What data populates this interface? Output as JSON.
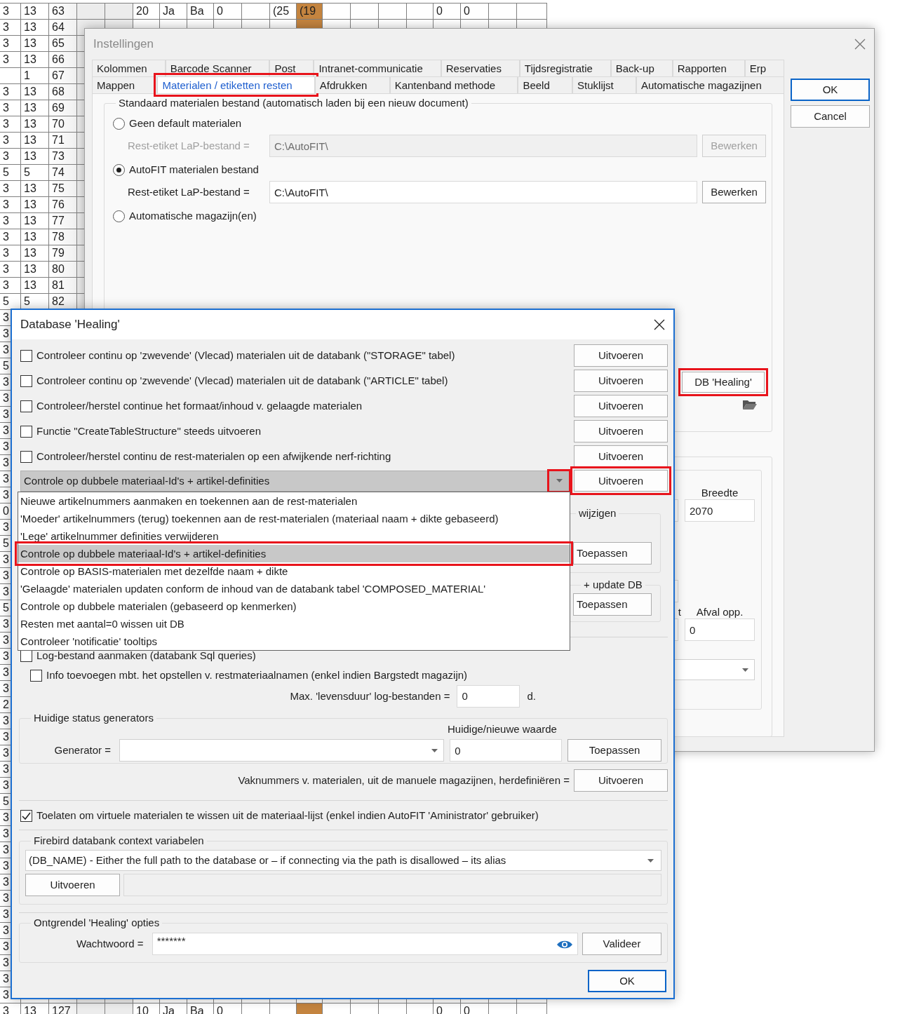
{
  "spreadsheet": {
    "rows": [
      {
        "cells": [
          "3",
          "13",
          "63",
          null,
          null,
          "20",
          "Ja",
          "Ba",
          "0",
          null,
          "(25",
          {
            "text": "(19",
            "color": "#c4843f"
          },
          null,
          null,
          null,
          null,
          "0",
          "0"
        ]
      },
      {
        "cells": [
          "3",
          "13",
          "64",
          null,
          null,
          null,
          null,
          null,
          null,
          null,
          null,
          {
            "color": "#c4843f"
          }
        ]
      },
      {
        "cells": [
          "3",
          "13",
          "65"
        ]
      },
      {
        "cells": [
          "3",
          "13",
          "66"
        ]
      },
      {
        "cells": [
          null,
          "1",
          "67"
        ]
      },
      {
        "cells": [
          "3",
          "13",
          "68"
        ]
      },
      {
        "cells": [
          "3",
          "13",
          "69"
        ]
      },
      {
        "cells": [
          "3",
          "13",
          "70"
        ]
      },
      {
        "cells": [
          "3",
          "13",
          "71"
        ]
      },
      {
        "cells": [
          "3",
          "13",
          "73"
        ]
      },
      {
        "cells": [
          "5",
          "5",
          "74"
        ]
      },
      {
        "cells": [
          "3",
          "13",
          "75"
        ]
      },
      {
        "cells": [
          "3",
          "13",
          "76"
        ]
      },
      {
        "cells": [
          "3",
          "13",
          "77"
        ]
      },
      {
        "cells": [
          "3",
          "13",
          "78"
        ]
      },
      {
        "cells": [
          "3",
          "13",
          "79"
        ]
      },
      {
        "cells": [
          "3",
          "13",
          "80"
        ]
      },
      {
        "cells": [
          "3",
          "13",
          "81"
        ]
      },
      {
        "cells": [
          "5",
          "5",
          "82"
        ]
      },
      {
        "cells": [
          "3"
        ]
      },
      {
        "cells": [
          "3"
        ]
      },
      {
        "cells": [
          "3"
        ]
      },
      {
        "cells": [
          "5"
        ]
      },
      {
        "cells": [
          "3"
        ]
      },
      {
        "cells": [
          "3"
        ]
      },
      {
        "cells": [
          "3"
        ]
      },
      {
        "cells": [
          "3"
        ]
      },
      {
        "cells": [
          "3"
        ]
      },
      {
        "cells": [
          "3"
        ]
      },
      {
        "cells": [
          "3"
        ]
      },
      {
        "cells": [
          "3"
        ]
      },
      {
        "cells": [
          "0"
        ]
      },
      {
        "cells": [
          "3"
        ]
      },
      {
        "cells": [
          "5"
        ]
      },
      {
        "cells": [
          "3"
        ]
      },
      {
        "cells": [
          "3"
        ]
      },
      {
        "cells": [
          "3"
        ]
      },
      {
        "cells": [
          "5"
        ]
      },
      {
        "cells": [
          "3"
        ]
      },
      {
        "cells": [
          "3"
        ]
      },
      {
        "cells": [
          "3"
        ]
      },
      {
        "cells": [
          "3"
        ]
      },
      {
        "cells": [
          "3"
        ]
      },
      {
        "cells": [
          "2"
        ]
      },
      {
        "cells": [
          "3"
        ]
      },
      {
        "cells": [
          "3"
        ]
      },
      {
        "cells": [
          "3"
        ]
      },
      {
        "cells": [
          "3"
        ]
      },
      {
        "cells": [
          "3"
        ]
      },
      {
        "cells": [
          "5"
        ]
      },
      {
        "cells": [
          "3"
        ]
      },
      {
        "cells": [
          "3"
        ]
      },
      {
        "cells": [
          "3"
        ]
      },
      {
        "cells": [
          "3"
        ]
      },
      {
        "cells": [
          "3"
        ]
      },
      {
        "cells": [
          "3"
        ]
      },
      {
        "cells": [
          "3"
        ]
      },
      {
        "cells": [
          "3"
        ]
      },
      {
        "cells": [
          "3"
        ]
      },
      {
        "cells": [
          "3"
        ]
      },
      {
        "cells": [
          "3"
        ]
      },
      {
        "cells": [
          "3"
        ]
      },
      {
        "cells": [
          "3",
          "13",
          "127",
          null,
          null,
          "10",
          "Ja",
          "Ba",
          "0",
          null,
          null,
          {
            "color": "#c4843f"
          },
          null,
          null,
          null,
          null,
          "0",
          "0"
        ]
      }
    ]
  },
  "settings_window": {
    "title": "Instellingen",
    "active": false,
    "tab_rows": [
      [
        {
          "label": "Kolommen",
          "selected": false,
          "annotated": false
        },
        {
          "label": "Barcode Scanner",
          "selected": false,
          "annotated": false
        },
        {
          "label": "Post",
          "selected": false,
          "annotated": false
        },
        {
          "label": "Intranet-communicatie",
          "selected": false,
          "annotated": false
        },
        {
          "label": "Reservaties",
          "selected": false,
          "annotated": false
        },
        {
          "label": "Tijdsregistratie",
          "selected": false,
          "annotated": false
        },
        {
          "label": "Back-up",
          "selected": false,
          "annotated": false
        },
        {
          "label": "Rapporten",
          "selected": false,
          "annotated": false
        },
        {
          "label": "Erp",
          "selected": false,
          "annotated": false
        }
      ],
      [
        {
          "label": "Mappen",
          "selected": false,
          "annotated": false
        },
        {
          "label": "Materialen / etiketten resten",
          "selected": true,
          "annotated": true
        },
        {
          "label": "Afdrukken",
          "selected": false,
          "annotated": false
        },
        {
          "label": "Kantenband methode",
          "selected": false,
          "annotated": false
        },
        {
          "label": "Beeld",
          "selected": false,
          "annotated": false
        },
        {
          "label": "Stuklijst",
          "selected": false,
          "annotated": false
        },
        {
          "label": "Automatische magazijnen",
          "selected": false,
          "annotated": false
        }
      ]
    ],
    "group_title": "Standaard materialen bestand (automatisch laden bij een nieuw document)",
    "options": [
      {
        "label": "Geen default materialen",
        "selected": false,
        "file_label": "Rest-etiket LaP-bestand =",
        "path": "C:\\AutoFIT\\",
        "button": "Bewerken",
        "disabled": true
      },
      {
        "label": "AutoFIT materialen bestand",
        "selected": true,
        "file_label": "Rest-etiket LaP-bestand =",
        "path": "C:\\AutoFIT\\",
        "button": "Bewerken",
        "disabled": false
      },
      {
        "label": "Automatische magazijn(en)",
        "selected": false
      }
    ],
    "healing_button": {
      "label": "DB 'Healing'",
      "annotated": true
    },
    "dimensions": {
      "width_label": "Breedte",
      "width_value": "2070",
      "partial_label": "t",
      "waste_label": "Afval opp.",
      "waste_value": "0"
    },
    "buttons": [
      {
        "label": "OK",
        "default": true
      },
      {
        "label": "Cancel",
        "default": false
      }
    ]
  },
  "healing_dialog": {
    "title": "Database 'Healing'",
    "checks": [
      {
        "label": "Controleer continu op 'zwevende' (Vlecad) materialen uit de databank (\"STORAGE\" tabel)",
        "checked": false,
        "button": "Uitvoeren"
      },
      {
        "label": "Controleer continu op 'zwevende' (Vlecad) materialen uit de databank (\"ARTICLE\" tabel)",
        "checked": false,
        "button": "Uitvoeren"
      },
      {
        "label": "Controleer/herstel continue het formaat/inhoud v. gelaagde materialen",
        "checked": false,
        "button": "Uitvoeren"
      },
      {
        "label": "Functie \"CreateTableStructure\" steeds uitvoeren",
        "checked": false,
        "button": "Uitvoeren"
      },
      {
        "label": "Controleer/herstel continu de rest-materialen op een afwijkende nerf-richting",
        "checked": false,
        "button": "Uitvoeren"
      }
    ],
    "action": {
      "value": "Controle op dubbele materiaal-Id's + artikel-definities",
      "expanded": true,
      "annotated": true,
      "button": "Uitvoeren",
      "button_annotated": true
    },
    "action_options": [
      {
        "label": "Nieuwe artikelnummers aanmaken en toekennen aan de rest-materialen",
        "selected": false,
        "annotated": false
      },
      {
        "label": "'Moeder' artikelnummers (terug) toekennen aan de rest-materialen (materiaal naam + dikte gebaseerd)",
        "selected": false,
        "annotated": false
      },
      {
        "label": "'Lege' artikelnummer definities verwijderen",
        "selected": false,
        "annotated": false
      },
      {
        "label": "Controle op dubbele materiaal-Id's + artikel-definities",
        "selected": true,
        "annotated": true
      },
      {
        "label": "Controle op BASIS-materialen met dezelfde naam + dikte",
        "selected": false,
        "annotated": false
      },
      {
        "label": "'Gelaagde' materialen updaten conform de inhoud van de databank tabel 'COMPOSED_MATERIAL'",
        "selected": false,
        "annotated": false
      },
      {
        "label": "Controle op dubbele materialen (gebaseerd op kenmerken)",
        "selected": false,
        "annotated": false
      },
      {
        "label": "Resten met aantal=0 wissen uit DB",
        "selected": false,
        "annotated": false
      },
      {
        "label": "Controleer 'notificatie' tooltips",
        "selected": false,
        "annotated": false
      }
    ],
    "hidden_groups": [
      {
        "title": "wijzigen",
        "button": "Toepassen"
      },
      {
        "title": "+ update DB",
        "button": "Toepassen"
      }
    ],
    "log_checks": [
      {
        "label": "Log-bestand aanmaken (databank Sql queries)",
        "checked": false
      },
      {
        "label": "Info toevoegen mbt. het opstellen v. restmateriaalnamen (enkel indien Bargstedt magazijn)",
        "checked": false
      }
    ],
    "log_lifetime": {
      "label": "Max. 'levensduur' log-bestanden =",
      "value": "0",
      "unit": "d."
    },
    "generators": {
      "title": "Huidige status generators",
      "value_header": "Huidige/nieuwe waarde",
      "label": "Generator =",
      "value": "0",
      "button": "Toepassen"
    },
    "renumber": {
      "label": "Vaknummers v. materialen, uit de manuele magazijnen, herdefiniëren =",
      "button": "Uitvoeren"
    },
    "virtual_delete": {
      "label": "Toelaten om virtuele materialen te wissen uit de materiaal-lijst (enkel indien AutoFIT 'Aministrator' gebruiker)",
      "checked": true
    },
    "firebird": {
      "title": "Firebird databank context variabelen",
      "variable": "(DB_NAME) - Either the full path to the database or – if connecting via the path is disallowed – its alias",
      "button": "Uitvoeren"
    },
    "unlock": {
      "title": "Ontgrendel 'Healing' opties",
      "label": "Wachtwoord =",
      "value": "*******",
      "button": "Valideer"
    },
    "ok": {
      "label": "OK",
      "default": true
    }
  }
}
